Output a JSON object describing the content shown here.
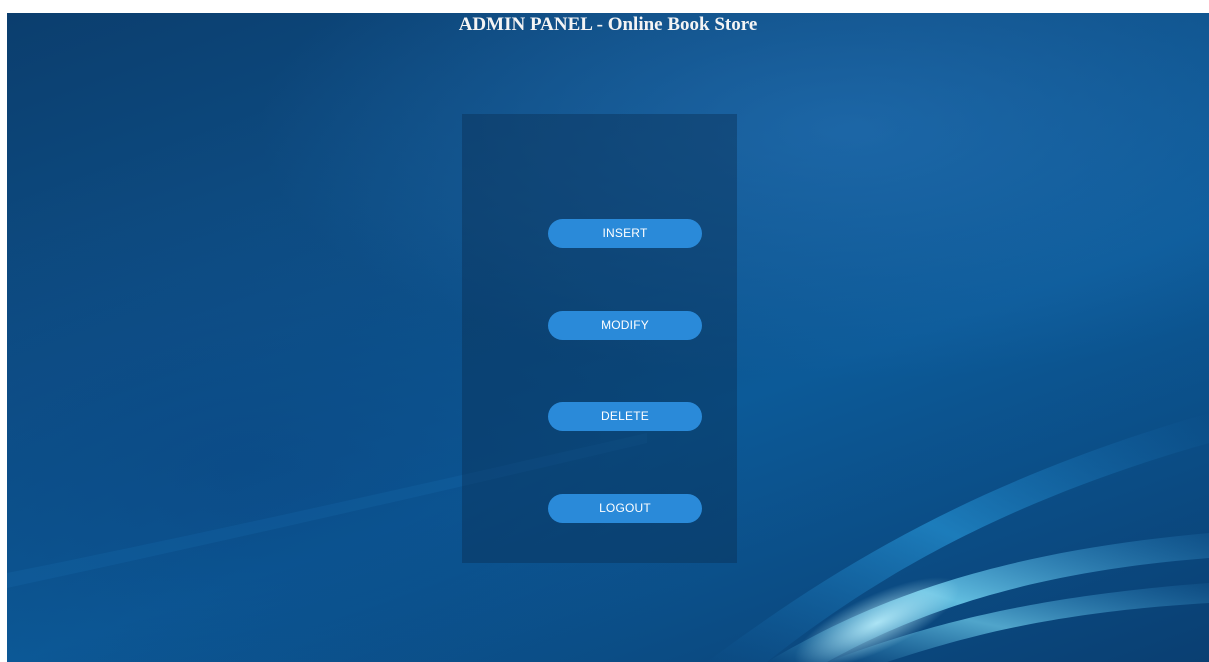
{
  "header": {
    "title": "ADMIN PANEL - Online Book Store"
  },
  "menu": {
    "insert_label": "INSERT",
    "modify_label": "MODIFY",
    "delete_label": "DELETE",
    "logout_label": "LOGOUT"
  },
  "colors": {
    "background": "#0e4f87",
    "panel": "#0a2f55",
    "button": "#2a8ad9",
    "title_text": "#f4f4f4"
  }
}
